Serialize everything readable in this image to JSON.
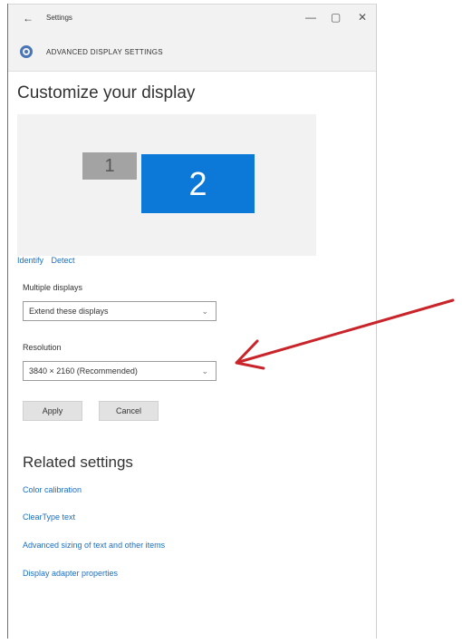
{
  "window": {
    "title": "Settings",
    "back_glyph": "←",
    "minimize_glyph": "—",
    "maximize_glyph": "▢",
    "close_glyph": "✕"
  },
  "header": {
    "label": "ADVANCED DISPLAY SETTINGS",
    "icon": "gear-icon"
  },
  "main": {
    "title": "Customize your display",
    "monitors": [
      {
        "label": "1"
      },
      {
        "label": "2"
      }
    ],
    "links": {
      "identify": "Identify",
      "detect": "Detect"
    },
    "multiple_displays": {
      "label": "Multiple displays",
      "value": "Extend these displays"
    },
    "resolution": {
      "label": "Resolution",
      "value": "3840 × 2160 (Recommended)"
    },
    "buttons": {
      "apply": "Apply",
      "cancel": "Cancel"
    }
  },
  "related": {
    "title": "Related settings",
    "links": [
      "Color calibration",
      "ClearType text",
      "Advanced sizing of text and other items",
      "Display adapter properties"
    ]
  },
  "colors": {
    "accent": "#0c78d7",
    "annotation_arrow": "#c8242a",
    "link": "#1a6fc4"
  }
}
